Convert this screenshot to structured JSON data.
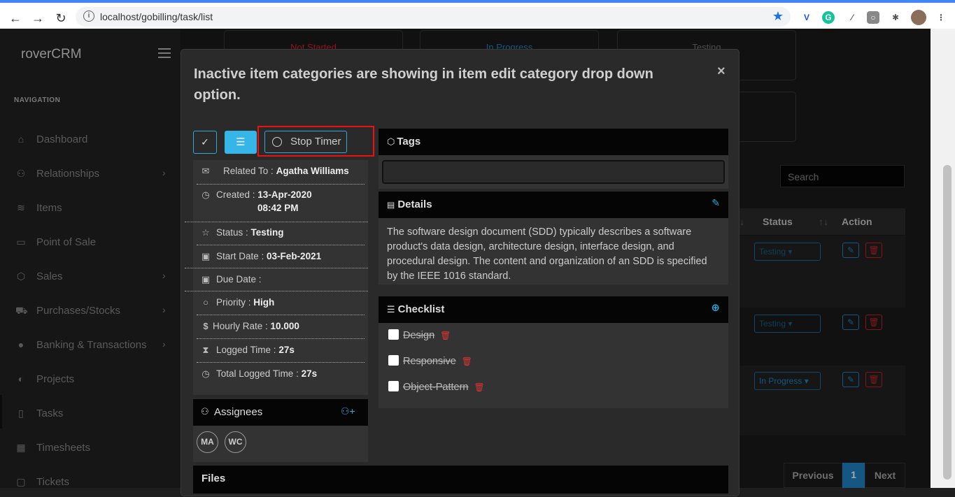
{
  "browser": {
    "url": "localhost/gobilling/task/list"
  },
  "sidebar": {
    "brand": "roverCRM",
    "nav_label": "NAVIGATION",
    "items": [
      {
        "label": "Dashboard",
        "icon": "home-icon",
        "chev": false
      },
      {
        "label": "Relationships",
        "icon": "users-icon",
        "chev": true
      },
      {
        "label": "Items",
        "icon": "layers-icon",
        "chev": false
      },
      {
        "label": "Point of Sale",
        "icon": "briefcase-icon",
        "chev": false
      },
      {
        "label": "Sales",
        "icon": "box-icon",
        "chev": true
      },
      {
        "label": "Purchases/Stocks",
        "icon": "cart-icon",
        "chev": true
      },
      {
        "label": "Banking & Transactions",
        "icon": "piggy-bank-icon",
        "chev": true
      },
      {
        "label": "Projects",
        "icon": "half-circle-icon",
        "chev": false
      },
      {
        "label": "Tasks",
        "icon": "clipboard-icon",
        "chev": false
      },
      {
        "label": "Timesheets",
        "icon": "calendar-icon",
        "chev": false
      },
      {
        "label": "Tickets",
        "icon": "ticket-icon",
        "chev": false
      }
    ]
  },
  "background": {
    "stat_cards": [
      "Not Started",
      "In Progress",
      "Testing"
    ],
    "search_placeholder": "Search",
    "table_headers": {
      "status": "Status",
      "action": "Action"
    },
    "rows": [
      {
        "status": "Testing"
      },
      {
        "status": "Testing"
      },
      {
        "status": "In Progress"
      }
    ],
    "pager": {
      "prev": "Previous",
      "page": "1",
      "next": "Next"
    }
  },
  "modal": {
    "title": "Inactive item categories are showing in item edit category drop down option.",
    "close": "×",
    "stop_timer": "Stop Timer",
    "info": {
      "related_to_label": "Related To :",
      "related_to": "Agatha Williams",
      "created_label": "Created :",
      "created_date": "13-Apr-2020",
      "created_time": "08:42 PM",
      "status_label": "Status :",
      "status": "Testing",
      "start_date_label": "Start Date :",
      "start_date": "03-Feb-2021",
      "due_date_label": "Due Date :",
      "due_date": "",
      "priority_label": "Priority :",
      "priority": "High",
      "hourly_rate_label": "Hourly Rate :",
      "hourly_rate": "10.000",
      "logged_time_label": "Logged Time :",
      "logged_time": "27s",
      "total_logged_label": "Total Logged Time :",
      "total_logged": "27s"
    },
    "assignees": {
      "title": "Assignees",
      "people": [
        "MA",
        "WC"
      ]
    },
    "tags": {
      "title": "Tags"
    },
    "details": {
      "title": "Details",
      "text": "The software design document (SDD) typically describes a software product's data design, architecture design, interface design, and procedural design. The content and organization of an SDD is specified by the IEEE 1016 standard."
    },
    "checklist": {
      "title": "Checklist",
      "items": [
        "Design",
        "Responsive",
        "Object-Pattern"
      ]
    },
    "files": {
      "title": "Files"
    }
  }
}
